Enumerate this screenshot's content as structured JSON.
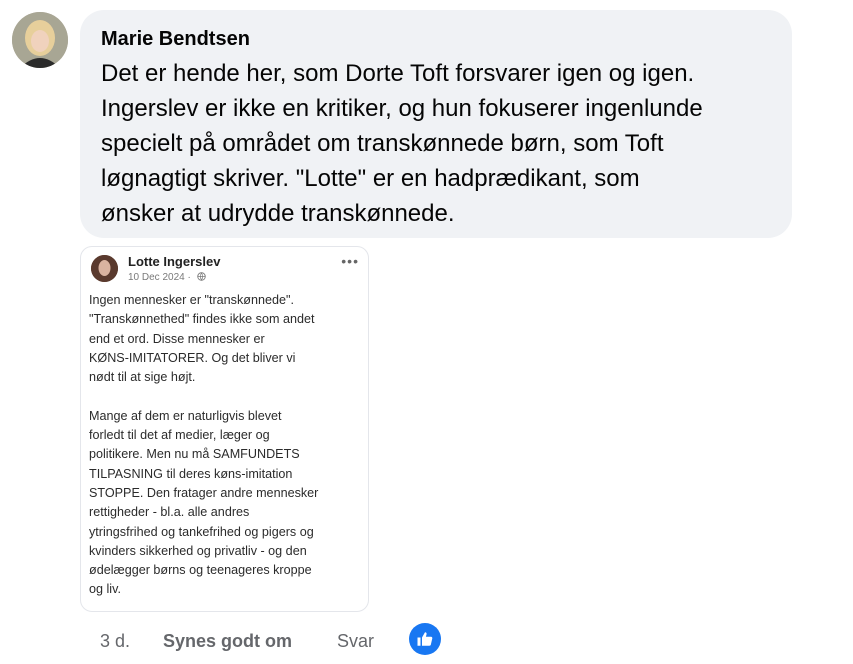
{
  "comment": {
    "author": "Marie Bendtsen",
    "text": "Det er hende her, som Dorte Toft forsvarer igen og igen.\nIngerslev er ikke en kritiker, og hun fokuserer ingenlunde\nspecielt på området om transkønnede børn, som Toft\nløgnagtigt skriver. \"Lotte\" er en hadprædikant, som\nønsker at udrydde transkønnede."
  },
  "attachment": {
    "author": "Lotte Ingerslev",
    "date": "10 Dec 2024 ·",
    "more_icon": "more-dots-icon",
    "privacy_icon": "globe-icon",
    "body": "Ingen mennesker er \"transkønnede\".\n\"Transkønnethed\" findes ikke som andet\nend et ord. Disse mennesker er\nKØNS-IMITATORER. Og det bliver vi\nnødt til at sige højt.\n\nMange af dem er naturligvis blevet\nforledt til det af medier, læger og\npolitikere. Men nu må SAMFUNDETS\nTILPASNING til deres køns-imitation\nSTOPPE. Den fratager andre mennesker\nrettigheder - bl.a. alle andres\nytringsfrihed og tankefrihed og pigers og\nkvinders sikkerhed og privatliv - og den\nødelægger børns og teenageres kroppe\nog liv."
  },
  "actions": {
    "time": "3 d.",
    "like_label": "Synes godt om",
    "reply_label": "Svar",
    "reaction_icon": "thumbs-up-icon",
    "reaction_color": "#1877f2"
  },
  "colors": {
    "bubble_bg": "#f0f2f5",
    "secondary_text": "#65676b"
  }
}
